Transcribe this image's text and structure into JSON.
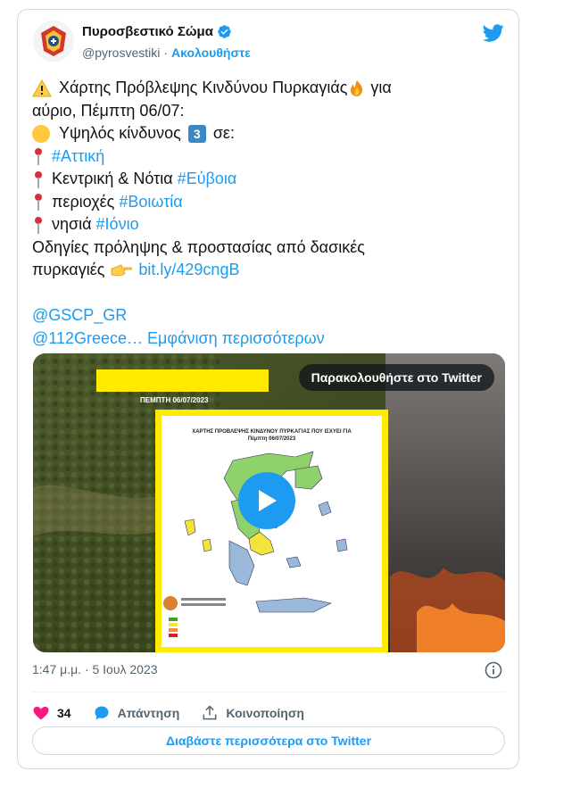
{
  "author": {
    "name": "Πυροσβεστικό Σώμα",
    "handle": "@pyrosvestiki",
    "separator": "·",
    "follow_label": "Ακολουθήστε"
  },
  "tweet": {
    "line1_a": "Χάρτης Πρόβλεψης Κινδύνου Πυρκαγιάς",
    "line1_b": "για",
    "line2": "αύριο, Πέμπτη 06/07:",
    "line3_a": "Υψηλός κίνδυνος",
    "line3_badge": "3",
    "line3_b": "σε:",
    "line4_link": "#Αττική",
    "line5_a": "Κεντρική & Νότια",
    "line5_link": "#Εύβοια",
    "line6_a": "περιοχές",
    "line6_link": "#Βοιωτία",
    "line7_a": "νησιά",
    "line7_link": "#Ιόνιο",
    "line8": "Οδηγίες πρόληψης & προστασίας από δασικές",
    "line9_a": "πυρκαγιές",
    "line9_link": "bit.ly/429cngB",
    "mention1": "@GSCP_GR",
    "mention2": "@112Greece…",
    "show_more": "Εμφάνιση περισσότερων"
  },
  "media": {
    "watch_label": "Παρακολουθήστε στο Twitter",
    "date_label": "ΠΕΜΠΤΗ 06/07/2023",
    "map_title_1": "ΧΑΡΤΗΣ ΠΡΟΒΛΕΨΗΣ ΚΙΝΔΥΝΟΥ ΠΥΡΚΑΓΙΑΣ ΠΟΥ ΙΣΧΥΕΙ ΓΙΑ",
    "map_title_2": "Πέμπτη 06/07/2023"
  },
  "meta": {
    "timestamp": "1:47 μ.μ. · 5 Ιουλ 2023"
  },
  "actions": {
    "likes": "34",
    "reply_label": "Απάντηση",
    "share_label": "Κοινοποίηση",
    "read_more": "Διαβάστε περισσότερα στο Twitter"
  },
  "colors": {
    "accent": "#1d9bf0",
    "like": "#f91880",
    "yellow": "#ffeb00"
  },
  "icons": [
    "verified-badge-icon",
    "twitter-bird-icon",
    "warning-icon",
    "fire-icon",
    "yellow-circle-icon",
    "pin-icon",
    "pointing-hand-icon",
    "play-icon",
    "info-icon",
    "heart-icon",
    "reply-bubble-icon",
    "share-icon"
  ]
}
